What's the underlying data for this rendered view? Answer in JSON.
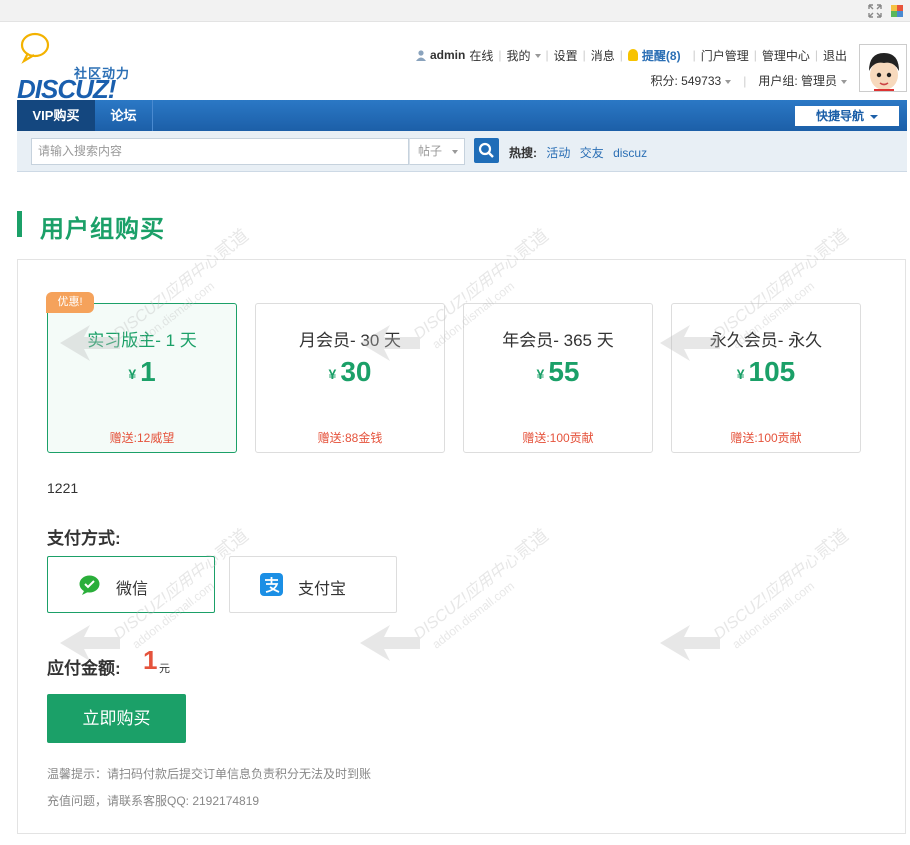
{
  "header": {
    "logo_sub": "社区动力",
    "logo_main": "DISCUZ!",
    "user": {
      "username": "admin",
      "status": "在线",
      "links": [
        "我的",
        "设置",
        "消息"
      ],
      "notify": "提醒(8)",
      "admin_links": [
        "门户管理",
        "管理中心",
        "退出"
      ]
    },
    "stats": {
      "points": "积分: 549733",
      "group": "用户组: 管理员"
    }
  },
  "nav": {
    "items": [
      "VIP购买",
      "论坛"
    ],
    "quick_nav": "快捷导航"
  },
  "search": {
    "placeholder": "请输入搜索内容",
    "type": "帖子",
    "hot_label": "热搜:",
    "hot_links": [
      "活动",
      "交友",
      "discuz"
    ]
  },
  "page": {
    "title": "用户组购买",
    "promo_tag": "优惠!",
    "plans": [
      {
        "name": "实习版主- 1 天",
        "currency": "¥",
        "price": "1",
        "gift": "赠送:12威望"
      },
      {
        "name": "月会员- 30 天",
        "currency": "¥",
        "price": "30",
        "gift": "赠送:88金钱"
      },
      {
        "name": "年会员- 365 天",
        "currency": "¥",
        "price": "55",
        "gift": "赠送:100贡献"
      },
      {
        "name": "永久会员- 永久",
        "currency": "¥",
        "price": "105",
        "gift": "赠送:100贡献"
      }
    ],
    "note": "1221",
    "pay_label": "支付方式:",
    "pay_methods": [
      "微信",
      "支付宝"
    ],
    "amount_label": "应付金额:",
    "amount_value": "1",
    "amount_unit": "元",
    "buy_button": "立即购买",
    "tips": [
      "温馨提示：请扫码付款后提交订单信息负责积分无法及时到账",
      "充值问题，请联系客服QQ: 2192174819"
    ]
  },
  "watermark": {
    "line1": "DISCUZ!应用中心",
    "line2": "addon.dismall.com",
    "badge": "贰道"
  },
  "colors": {
    "accent_green": "#1ba068",
    "price_red": "#e5533c",
    "nav_blue": "#1c5fa8",
    "promo_orange": "#f5a25b"
  }
}
